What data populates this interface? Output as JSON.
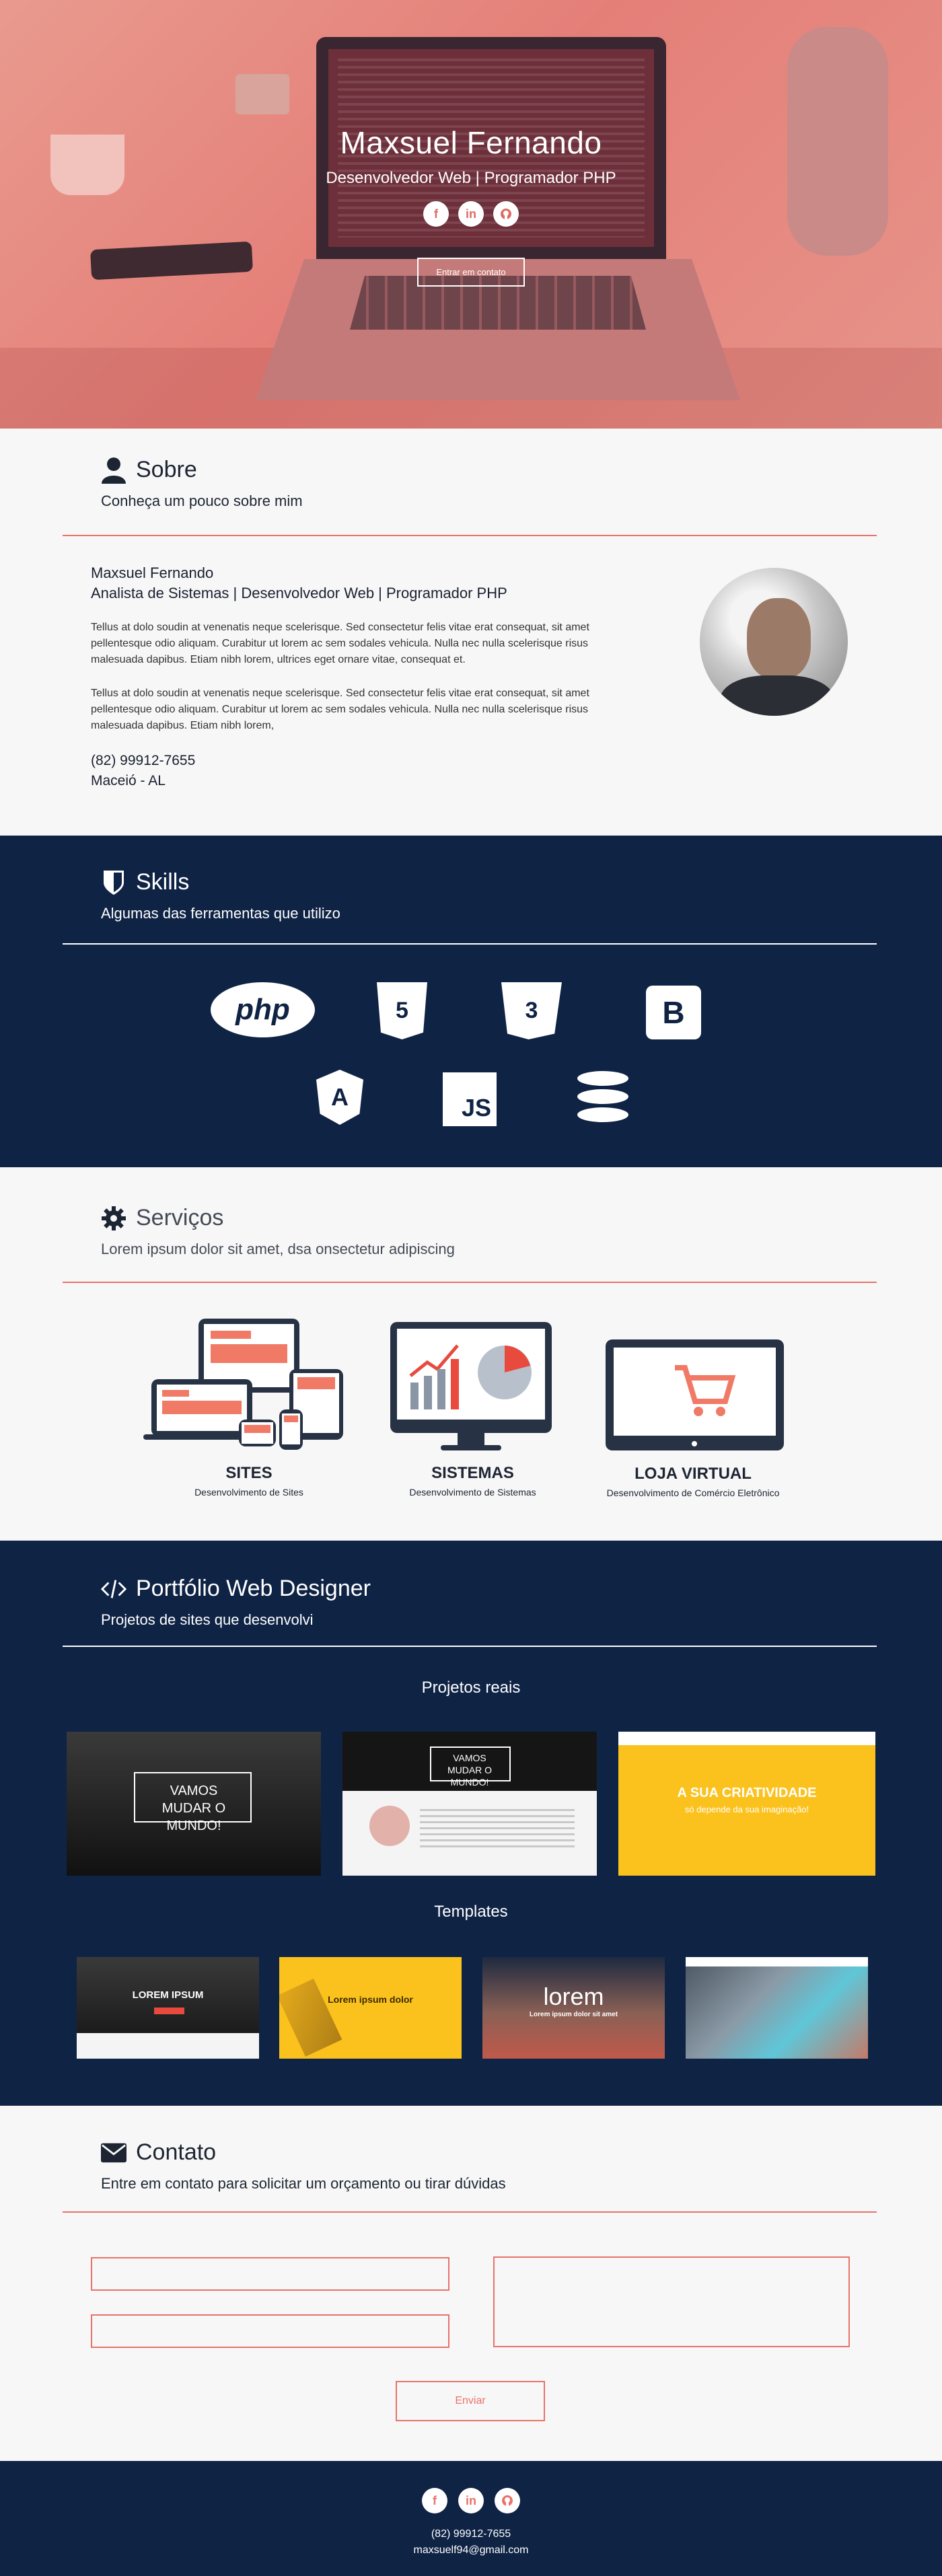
{
  "hero": {
    "name": "Maxsuel Fernando",
    "subtitle": "Desenvolvedor Web | Programador PHP",
    "cta": "Entrar em contato",
    "socials": [
      "f",
      "in",
      "gh"
    ]
  },
  "sobre": {
    "title": "Sobre",
    "subtitle": "Conheça um pouco sobre mim",
    "name": "Maxsuel Fernando",
    "role": "Analista de Sistemas | Desenvolvedor Web | Programador PHP",
    "p1": "Tellus at dolo soudin at venenatis neque scelerisque. Sed consectetur felis vitae erat consequat, sit amet pellentesque odio aliquam. Curabitur ut lorem ac sem sodales vehicula. Nulla nec nulla scelerisque risus malesuada dapibus. Etiam nibh lorem, ultrices eget ornare vitae, consequat et.",
    "p2": "Tellus at dolo soudin at venenatis neque scelerisque. Sed consectetur felis vitae erat consequat, sit amet pellentesque odio aliquam. Curabitur ut lorem ac sem sodales vehicula. Nulla nec nulla scelerisque risus malesuada dapibus. Etiam nibh lorem,",
    "phone": "(82) 99912-7655",
    "city": "Maceió - AL"
  },
  "skills": {
    "title": "Skills",
    "subtitle": "Algumas das ferramentas que utilizo",
    "items": {
      "php": "php",
      "html5": "5",
      "css3": "3",
      "bootstrap": "B",
      "angular": "A",
      "js": "JS"
    }
  },
  "servicos": {
    "title": "Serviços",
    "subtitle": "Lorem ipsum dolor sit amet, dsa onsectetur adipiscing",
    "items": [
      {
        "title": "SITES",
        "desc": "Desenvolvimento de Sites"
      },
      {
        "title": "SISTEMAS",
        "desc": "Desenvolvimento de Sistemas"
      },
      {
        "title": "LOJA VIRTUAL",
        "desc": "Desenvolvimento de Comércio Eletrônico"
      }
    ]
  },
  "portfolio": {
    "title": "Portfólio Web Designer",
    "subtitle": "Projetos de sites que desenvolvi",
    "real_label": "Projetos reais",
    "templates_label": "Templates",
    "real": [
      {
        "text": "VAMOS MUDAR O MUNDO!"
      },
      {
        "text": "VAMOS MUDAR O MUNDO!"
      },
      {
        "text": "A SUA CRIATIVIDADE",
        "text2": "só depende da sua imaginação!"
      }
    ],
    "templates": [
      {
        "text": "LOREM IPSUM"
      },
      {
        "text": "Lorem ipsum dolor"
      },
      {
        "text": "lorem",
        "text2": "Lorem ipsum dolor sit amet"
      },
      {
        "text": ""
      }
    ]
  },
  "contato": {
    "title": "Contato",
    "subtitle": "Entre em contato para solicitar um orçamento ou tirar dúvidas",
    "send": "Enviar"
  },
  "footer": {
    "phone": "(82) 99912-7655",
    "email": "maxsuelf94@gmail.com"
  },
  "colors": {
    "accent": "#e8736b",
    "navy": "#0f2345",
    "light": "#f7f7f7",
    "hero_overlay": "#e47f78"
  }
}
